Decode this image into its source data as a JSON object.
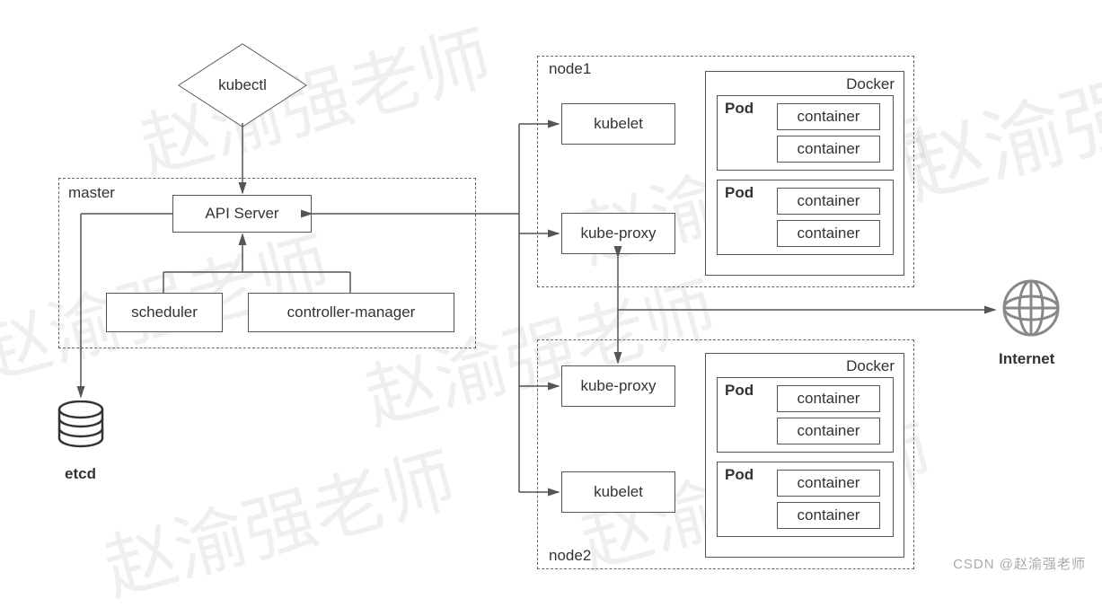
{
  "kubectl": "kubectl",
  "master": {
    "label": "master",
    "api_server": "API Server",
    "scheduler": "scheduler",
    "controller_manager": "controller-manager"
  },
  "etcd": "etcd",
  "node1": {
    "label": "node1",
    "kubelet": "kubelet",
    "kube_proxy": "kube-proxy",
    "docker": {
      "label": "Docker",
      "pods": [
        {
          "label": "Pod",
          "containers": [
            "container",
            "container"
          ]
        },
        {
          "label": "Pod",
          "containers": [
            "container",
            "container"
          ]
        }
      ]
    }
  },
  "node2": {
    "label": "node2",
    "kubelet": "kubelet",
    "kube_proxy": "kube-proxy",
    "docker": {
      "label": "Docker",
      "pods": [
        {
          "label": "Pod",
          "containers": [
            "container",
            "container"
          ]
        },
        {
          "label": "Pod",
          "containers": [
            "container",
            "container"
          ]
        }
      ]
    }
  },
  "internet": "Internet",
  "credit": "CSDN @赵渝强老师",
  "watermark_text": "赵渝强老师"
}
